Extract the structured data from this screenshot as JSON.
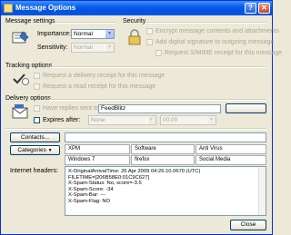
{
  "window": {
    "title": "Message Options",
    "help_glyph": "?",
    "close_glyph": "✕"
  },
  "message_settings": {
    "heading": "Message settings",
    "importance_label": "Importance:",
    "importance_value": "Normal",
    "sensitivity_label": "Sensitivity:",
    "sensitivity_value": "Normal"
  },
  "security": {
    "heading": "Security",
    "encrypt_label": "Encrypt message contents and attachments",
    "sign_label": "Add digital signature to outgoing message",
    "smime_label": "Request S/MIME receipt for this message"
  },
  "tracking": {
    "heading": "Tracking options",
    "delivery_label": "Request a delivery receipt for this message",
    "read_label": "Request a read receipt for this message"
  },
  "delivery": {
    "heading": "Delivery options",
    "replies_label": "Have replies sent to:",
    "replies_value": "FeedBlitz",
    "expires_label": "Expires after:",
    "expires_date": "None",
    "expires_time": "00:00"
  },
  "contacts_button": "Contacts...",
  "categories_button": "Categories",
  "categories_arrow": "▼",
  "categories": {
    "row1": [
      "XPM",
      "Software",
      "Anti Virus"
    ],
    "row2": [
      "Windows 7",
      "firefox",
      "Social Media"
    ]
  },
  "headers_label": "Internet headers:",
  "headers_lines": [
    "X-OriginalArrivalTime: 26 Apr 2009 04:26:10.0670 (UTC)",
    "FILETIME=[206B58E0:01C9C627]",
    "X-Spam-Status: No, score=-3.5",
    "X-Spam-Score: -34",
    "X-Spam-Bar: ---",
    "X-Spam-Flag: NO"
  ],
  "close_button": "Close"
}
